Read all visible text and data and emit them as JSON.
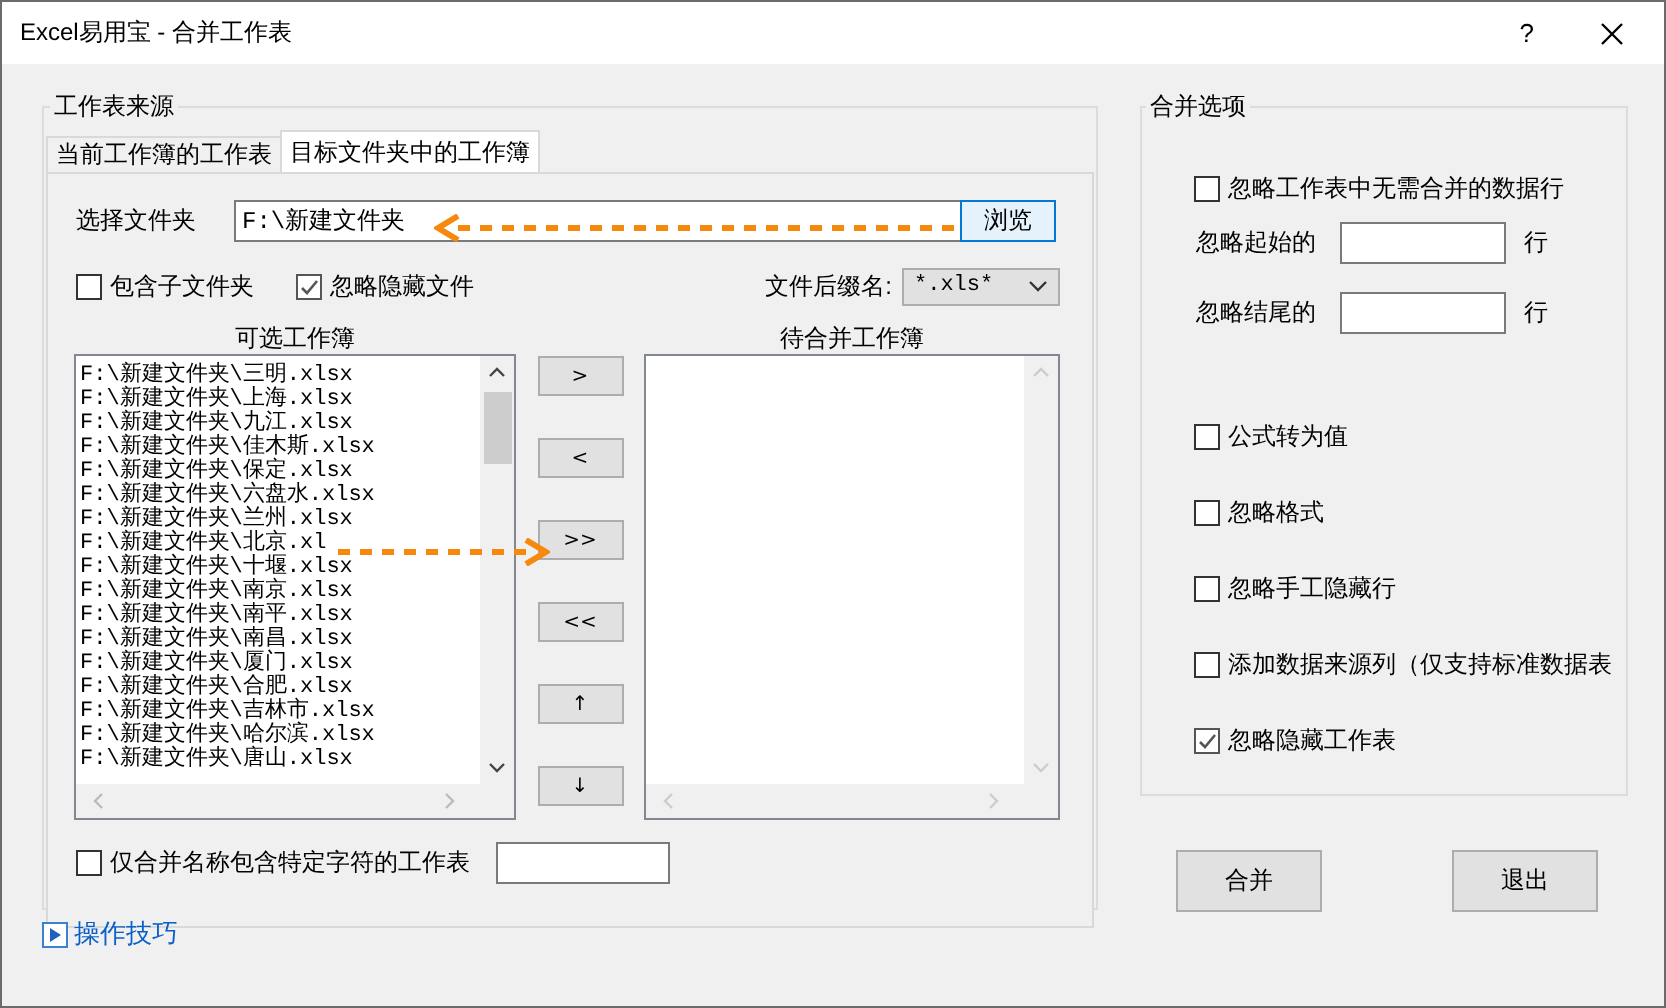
{
  "window": {
    "title": "Excel易用宝 - 合并工作表",
    "help": "?"
  },
  "source_group": {
    "title": "工作表来源",
    "tabs": [
      {
        "label": "当前工作簿的工作表",
        "selected": false
      },
      {
        "label": "目标文件夹中的工作簿",
        "selected": true
      }
    ],
    "folder": {
      "label": "选择文件夹",
      "value": "F:\\新建文件夹",
      "browse": "浏览"
    },
    "include_subfolders": {
      "label": "包含子文件夹",
      "checked": false
    },
    "ignore_hidden_files": {
      "label": "忽略隐藏文件",
      "checked": true
    },
    "extension": {
      "label": "文件后缀名:",
      "value": "*.xls*"
    },
    "available": {
      "title": "可选工作簿",
      "items": [
        "F:\\新建文件夹\\三明.xlsx",
        "F:\\新建文件夹\\上海.xlsx",
        "F:\\新建文件夹\\九江.xlsx",
        "F:\\新建文件夹\\佳木斯.xlsx",
        "F:\\新建文件夹\\保定.xlsx",
        "F:\\新建文件夹\\六盘水.xlsx",
        "F:\\新建文件夹\\兰州.xlsx",
        "F:\\新建文件夹\\北京.xl",
        "F:\\新建文件夹\\十堰.xlsx",
        "F:\\新建文件夹\\南京.xlsx",
        "F:\\新建文件夹\\南平.xlsx",
        "F:\\新建文件夹\\南昌.xlsx",
        "F:\\新建文件夹\\厦门.xlsx",
        "F:\\新建文件夹\\合肥.xlsx",
        "F:\\新建文件夹\\吉林市.xlsx",
        "F:\\新建文件夹\\哈尔滨.xlsx",
        "F:\\新建文件夹\\唐山.xlsx"
      ]
    },
    "move_buttons": [
      ">",
      "<",
      ">>",
      "<<",
      "↑",
      "↓"
    ],
    "pending": {
      "title": "待合并工作簿"
    },
    "name_filter": {
      "label": "仅合并名称包含特定字符的工作表",
      "checked": false
    }
  },
  "tips_link": "操作技巧",
  "options": {
    "title": "合并选项",
    "items": [
      {
        "kind": "checkbox",
        "label": "忽略工作表中无需合并的数据行",
        "checked": false
      },
      {
        "kind": "field",
        "label": "忽略起始的",
        "unit": "行"
      },
      {
        "kind": "field",
        "label": "忽略结尾的",
        "unit": "行"
      },
      {
        "kind": "checkbox",
        "label": "公式转为值",
        "checked": false
      },
      {
        "kind": "checkbox",
        "label": "忽略格式",
        "checked": false
      },
      {
        "kind": "checkbox",
        "label": "忽略手工隐藏行",
        "checked": false
      },
      {
        "kind": "checkbox",
        "label": "添加数据来源列（仅支持标准数据表",
        "checked": false
      },
      {
        "kind": "checkbox",
        "label": "忽略隐藏工作表",
        "checked": true
      }
    ]
  },
  "buttons": [
    "合并",
    "退出"
  ]
}
